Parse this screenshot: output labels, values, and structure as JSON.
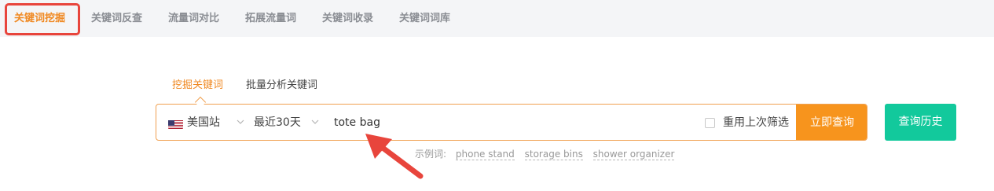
{
  "top_tabs": [
    {
      "label": "关键词挖掘",
      "active": true
    },
    {
      "label": "关键词反查",
      "active": false
    },
    {
      "label": "流量词对比",
      "active": false
    },
    {
      "label": "拓展流量词",
      "active": false
    },
    {
      "label": "关键词收录",
      "active": false
    },
    {
      "label": "关键词词库",
      "active": false
    }
  ],
  "sub_tabs": [
    {
      "label": "挖掘关键词",
      "active": true
    },
    {
      "label": "批量分析关键词",
      "active": false
    }
  ],
  "search": {
    "site_flag_icon": "us-flag-icon",
    "site": "美国站",
    "time_range": "最近30天",
    "query": "tote bag",
    "reuse_filter_label": "重用上次筛选",
    "reuse_filter_checked": false,
    "submit_label": "立即查询"
  },
  "history_button_label": "查询历史",
  "examples": {
    "label": "示例词:",
    "items": [
      "phone stand",
      "storage bins",
      "shower organizer"
    ]
  },
  "colors": {
    "accent": "#f7941d",
    "active_tab_text": "#f08a24",
    "history_button": "#12c99c",
    "annotation": "#e8453c"
  }
}
